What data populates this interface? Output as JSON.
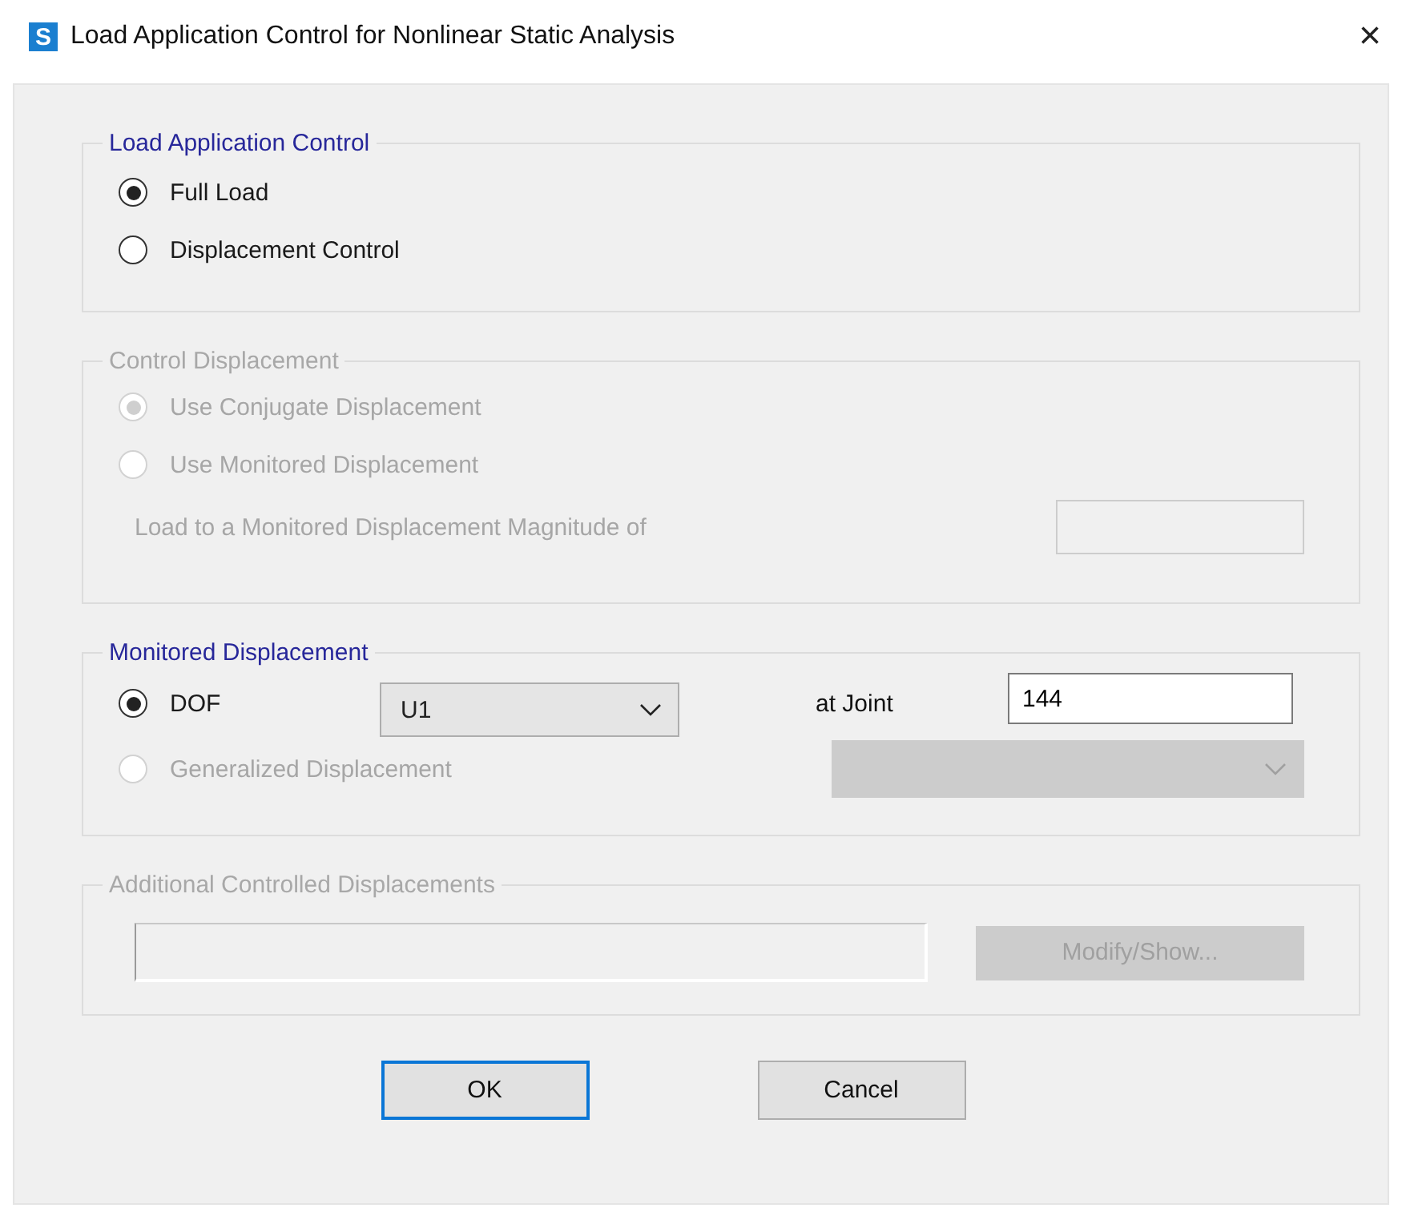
{
  "window": {
    "app_icon_letter": "S",
    "title": "Load Application Control for Nonlinear Static Analysis",
    "close": "×"
  },
  "load_application_control": {
    "title": "Load Application Control",
    "disabled": false,
    "options": [
      {
        "label": "Full Load",
        "selected": true
      },
      {
        "label": "Displacement Control",
        "selected": false
      }
    ]
  },
  "control_displacement": {
    "title": "Control Displacement",
    "disabled": true,
    "options": [
      {
        "label": "Use Conjugate Displacement",
        "selected": true
      },
      {
        "label": "Use Monitored Displacement",
        "selected": false
      }
    ],
    "magnitude_label": "Load to a Monitored Displacement Magnitude of"
  },
  "monitored_displacement": {
    "title": "Monitored Displacement",
    "disabled": false,
    "options": [
      {
        "label": "DOF",
        "selected": true,
        "disabled": false
      },
      {
        "label": "Generalized Displacement",
        "selected": false,
        "disabled": true
      }
    ],
    "dof_value": "U1",
    "joint_label": "at Joint",
    "joint_value": "144"
  },
  "additional_controlled_displacements": {
    "title": "Additional Controlled Displacements",
    "disabled": true,
    "button": "Modify/Show..."
  },
  "buttons": [
    {
      "label": "OK",
      "focused": true
    },
    {
      "label": "Cancel",
      "focused": false
    }
  ]
}
